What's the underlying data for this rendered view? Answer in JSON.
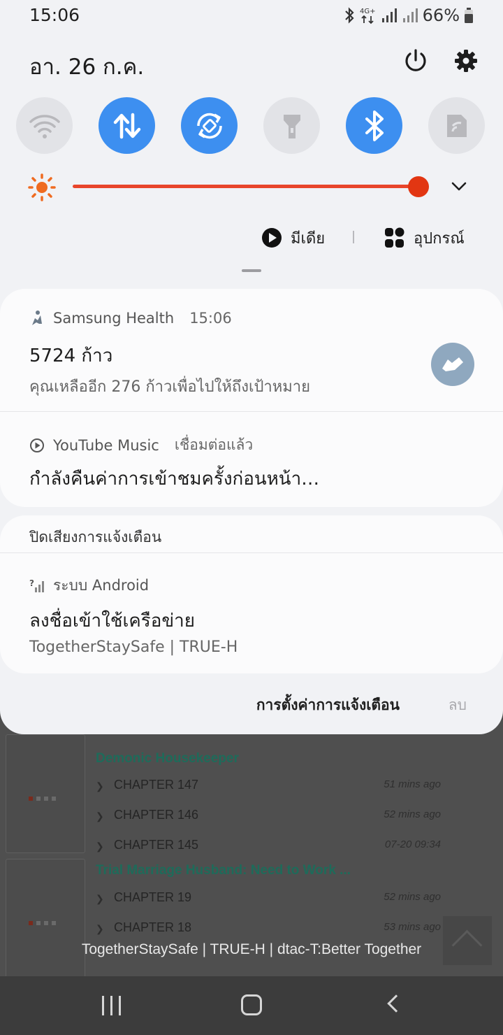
{
  "status_bar": {
    "time": "15:06",
    "network": "4G+",
    "battery": "66%"
  },
  "quick_panel": {
    "date": "อา. 26 ก.ค.",
    "tiles": [
      {
        "name": "wifi",
        "state": "off"
      },
      {
        "name": "mobile-data",
        "state": "on"
      },
      {
        "name": "auto-rotate",
        "state": "on"
      },
      {
        "name": "flashlight",
        "state": "off"
      },
      {
        "name": "bluetooth",
        "state": "on"
      },
      {
        "name": "nfc",
        "state": "off"
      }
    ],
    "brightness_level": 1.0,
    "media_label": "มีเดีย",
    "devices_label": "อุปกรณ์"
  },
  "notifications": {
    "health": {
      "app": "Samsung Health",
      "time": "15:06",
      "title": "5724 ก้าว",
      "text": "คุณเหลืออีก 276 ก้าวเพื่อไปให้ถึงเป้าหมาย"
    },
    "youtube": {
      "app": "YouTube Music",
      "status": "เชื่อมต่อแล้ว",
      "title": "กำลังคืนค่าการเข้าชมครั้งก่อนหน้า…"
    },
    "silent_header": "ปิดเสียงการแจ้งเตือน",
    "android": {
      "app": "ระบบ Android",
      "title": "ลงชื่อเข้าใช้เครือข่าย",
      "text": "TogetherStaySafe | TRUE-H"
    }
  },
  "actions": {
    "settings": "การตั้งค่าการแจ้งเตือน",
    "clear": "ลบ"
  },
  "background_app": {
    "manga": [
      {
        "title": "Demonic Housekeeper",
        "chapters": [
          {
            "name": "CHAPTER 147",
            "time": "51 mins ago"
          },
          {
            "name": "CHAPTER 146",
            "time": "52 mins ago"
          },
          {
            "name": "CHAPTER 145",
            "time": "07-20 09:34"
          }
        ]
      },
      {
        "title": "Trial Marriage Husband: Need to Work ...",
        "chapters": [
          {
            "name": "CHAPTER 19",
            "time": "52 mins ago"
          },
          {
            "name": "CHAPTER 18",
            "time": "53 mins ago"
          }
        ]
      }
    ]
  },
  "carrier_text": "TogetherStaySafe | TRUE-H | dtac-T:Better Together",
  "colors": {
    "accent": "#3d8ff0",
    "brightness": "#e8452b",
    "shade": "#f1f2f5"
  }
}
